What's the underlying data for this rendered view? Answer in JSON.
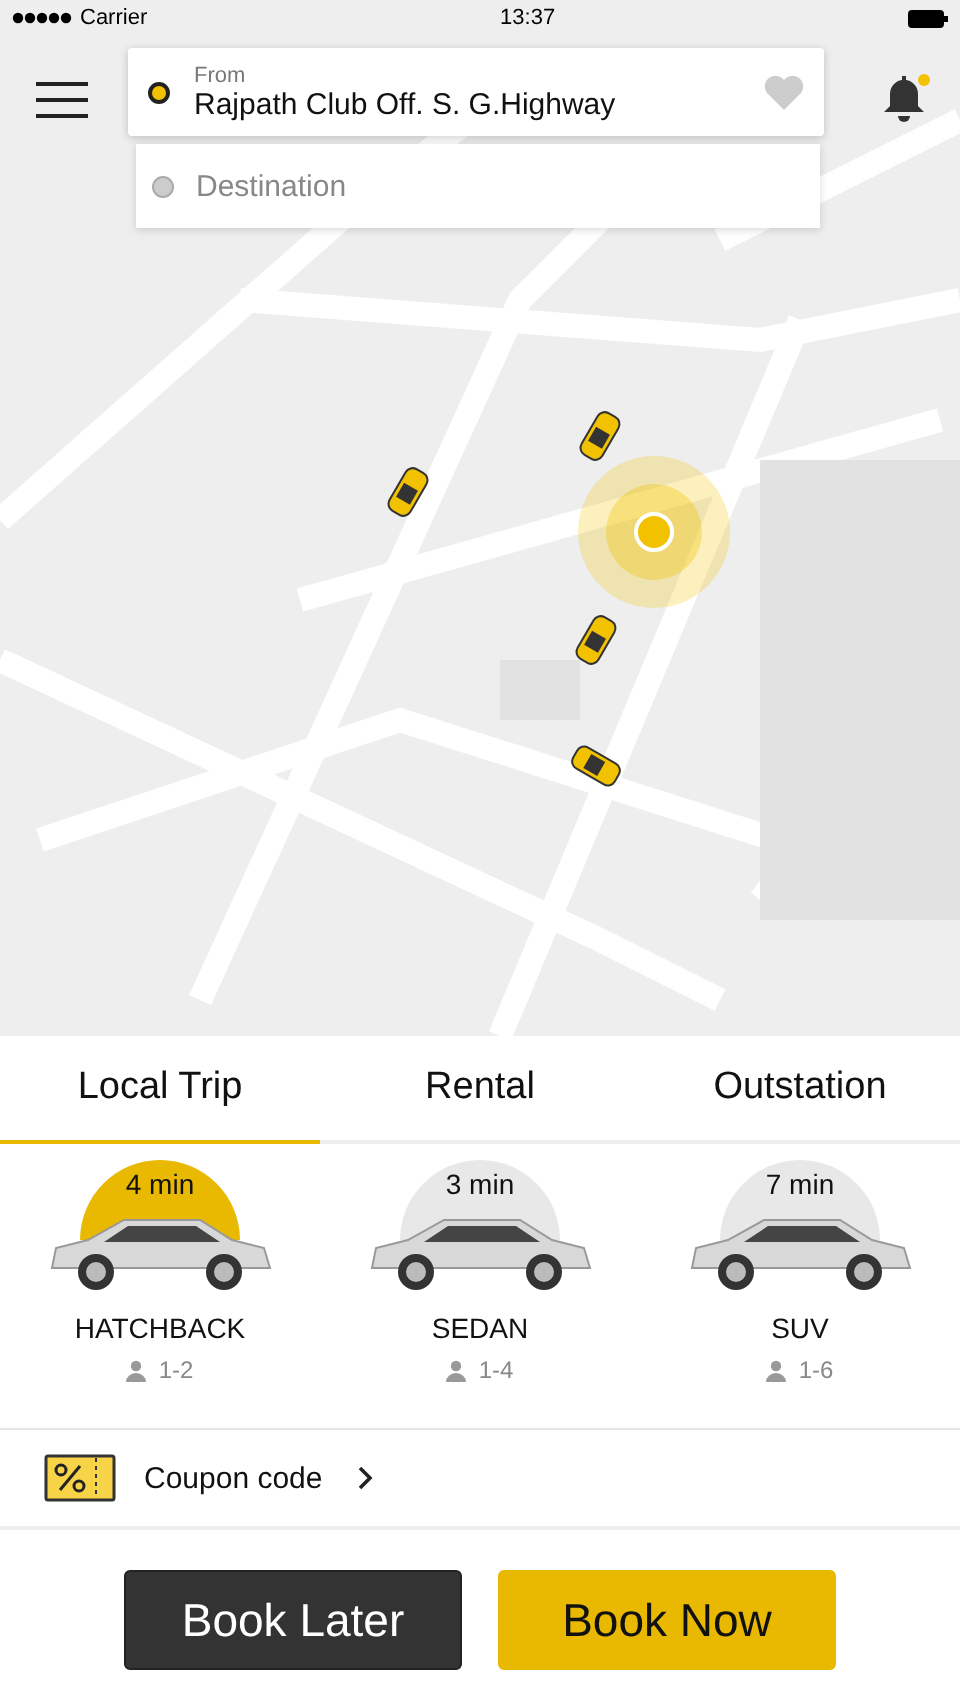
{
  "status_bar": {
    "carrier": "Carrier",
    "time": "13:37"
  },
  "search": {
    "from_label": "From",
    "from_value": "Rajpath Club Off. S. G.Highway",
    "destination_placeholder": "Destination"
  },
  "notifications": {
    "unread": true
  },
  "tabs": [
    {
      "label": "Local Trip",
      "selected": true
    },
    {
      "label": "Rental",
      "selected": false
    },
    {
      "label": "Outstation",
      "selected": false
    }
  ],
  "vehicles": [
    {
      "eta": "4 min",
      "name": "HATCHBACK",
      "seats": "1-2",
      "selected": true
    },
    {
      "eta": "3 min",
      "name": "SEDAN",
      "seats": "1-4",
      "selected": false
    },
    {
      "eta": "7 min",
      "name": "SUV",
      "seats": "1-6",
      "selected": false
    }
  ],
  "coupon": {
    "label": "Coupon code"
  },
  "buttons": [
    {
      "label": "Book Later",
      "kind": "secondary"
    },
    {
      "label": "Book Now",
      "kind": "primary"
    }
  ]
}
